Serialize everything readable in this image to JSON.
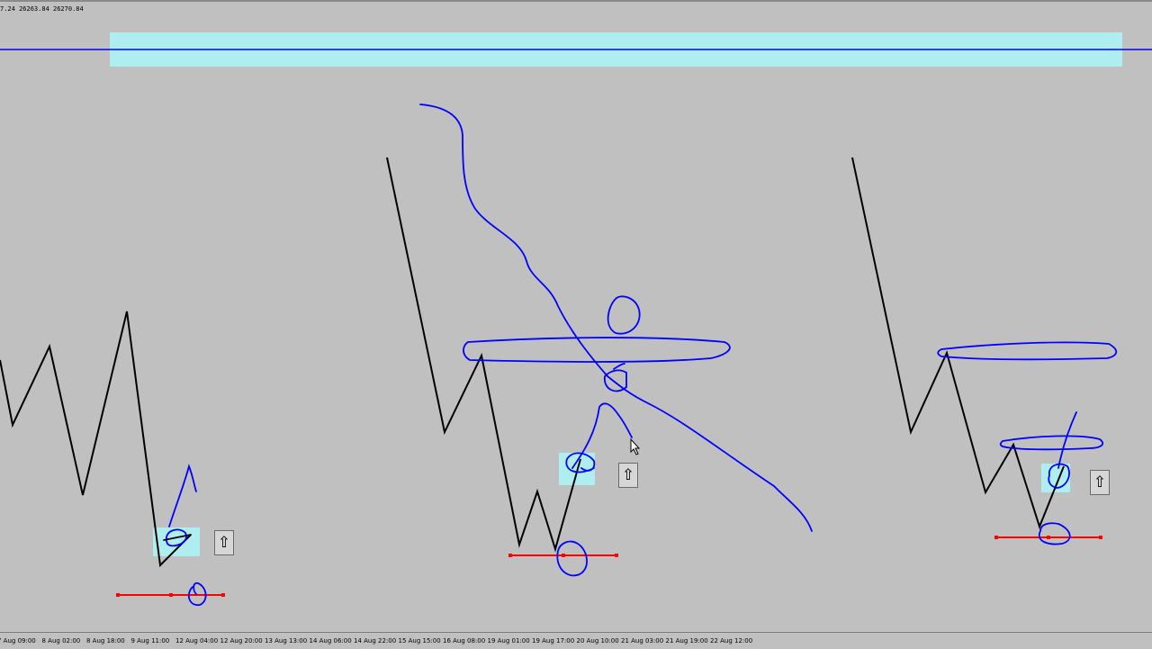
{
  "header": {
    "price_info": "7.24 26263.84 26270.84"
  },
  "time_axis": {
    "labels": [
      "7 Aug 09:00",
      "8 Aug 02:00",
      "8 Aug 18:00",
      "9 Aug 11:00",
      "12 Aug 04:00",
      "12 Aug 20:00",
      "13 Aug 13:00",
      "14 Aug 06:00",
      "14 Aug 22:00",
      "15 Aug 15:00",
      "16 Aug 08:00",
      "19 Aug 01:00",
      "19 Aug 17:00",
      "20 Aug 10:00",
      "21 Aug 03:00",
      "21 Aug 19:00",
      "22 Aug 12:00"
    ]
  },
  "objects": {
    "arrow_symbol": "⇧",
    "zone_color": "#aeeef0",
    "price_line_color": "#0000ff",
    "drawing_color": "#0000ff",
    "support_line_color": "#ff0000",
    "price_path_color": "#000000"
  }
}
